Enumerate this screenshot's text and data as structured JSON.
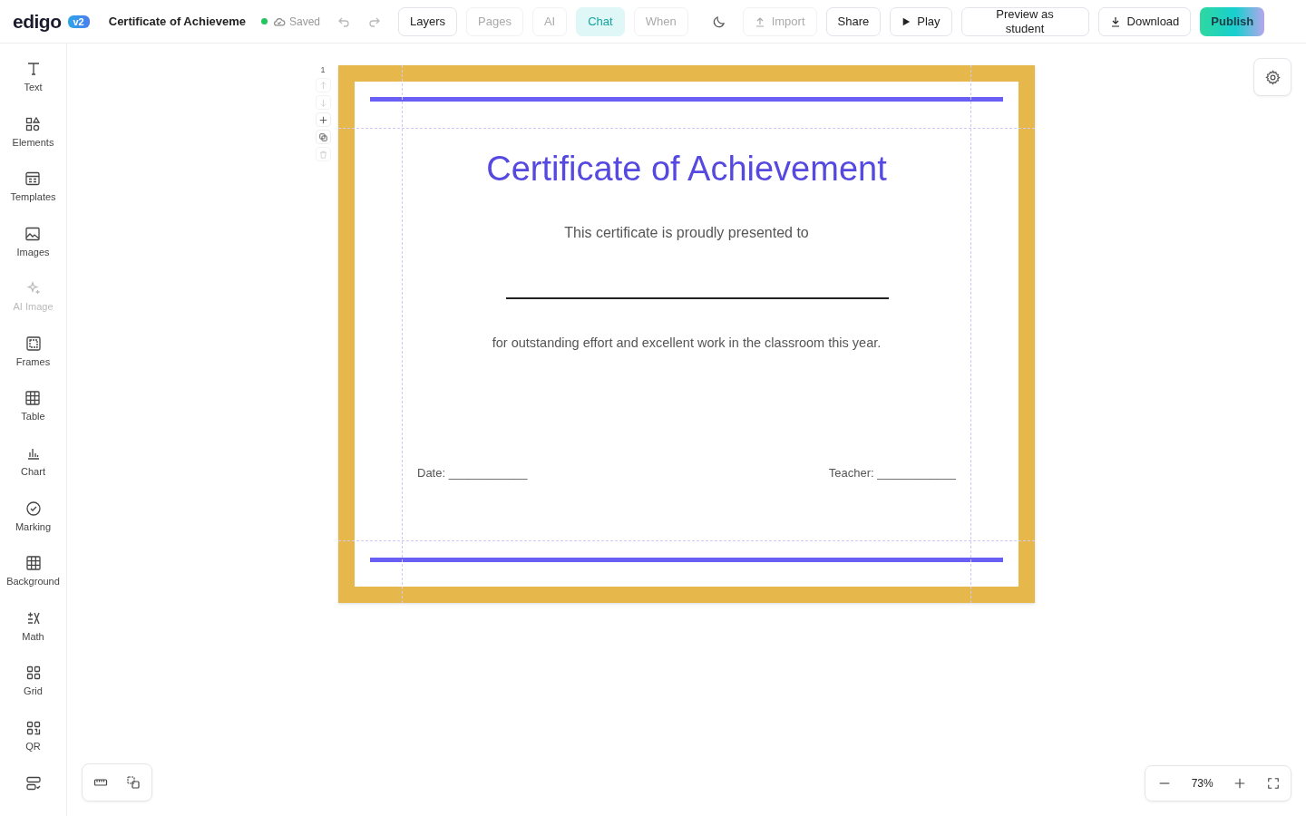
{
  "app": {
    "logo": "edigo",
    "version": "v2",
    "document_title": "Certificate of Achieveme",
    "save_status": "Saved"
  },
  "tabs": [
    {
      "label": "Layers",
      "selected": false,
      "disabled": false
    },
    {
      "label": "Pages",
      "selected": false,
      "disabled": true
    },
    {
      "label": "AI",
      "selected": false,
      "disabled": true
    },
    {
      "label": "Chat",
      "selected": true,
      "disabled": false
    },
    {
      "label": "When",
      "selected": false,
      "disabled": true
    }
  ],
  "actions": [
    {
      "kind": "import",
      "label": "Import",
      "disabled": true
    },
    {
      "kind": "share",
      "label": "Share",
      "disabled": false
    },
    {
      "kind": "play",
      "label": "Play",
      "disabled": false
    },
    {
      "kind": "preview",
      "label": "Preview as student",
      "disabled": false
    },
    {
      "kind": "download",
      "label": "Download",
      "disabled": false
    },
    {
      "kind": "publish",
      "label": "Publish",
      "disabled": false
    }
  ],
  "sidebar": {
    "items": [
      {
        "kind": "text",
        "label": "Text",
        "disabled": false
      },
      {
        "kind": "elements",
        "label": "Elements",
        "disabled": false
      },
      {
        "kind": "templates",
        "label": "Templates",
        "disabled": false
      },
      {
        "kind": "images",
        "label": "Images",
        "disabled": false
      },
      {
        "kind": "ai",
        "label": "AI Image",
        "disabled": true
      },
      {
        "kind": "frames",
        "label": "Frames",
        "disabled": false
      },
      {
        "kind": "table",
        "label": "Table",
        "disabled": false
      },
      {
        "kind": "chart",
        "label": "Chart",
        "disabled": false
      },
      {
        "kind": "marking",
        "label": "Marking",
        "disabled": false
      },
      {
        "kind": "background",
        "label": "Background",
        "disabled": false
      },
      {
        "kind": "math",
        "label": "Math",
        "disabled": false
      },
      {
        "kind": "grid",
        "label": "Grid",
        "disabled": false
      },
      {
        "kind": "qr",
        "label": "QR",
        "disabled": false
      },
      {
        "kind": "forms",
        "disabled": false
      }
    ]
  },
  "page_controls": {
    "page_number": "1",
    "buttons": [
      {
        "kind": "up",
        "disabled": true
      },
      {
        "kind": "down",
        "disabled": true
      },
      {
        "kind": "add",
        "disabled": false
      },
      {
        "kind": "copy",
        "disabled": false
      },
      {
        "kind": "delete",
        "disabled": true
      }
    ]
  },
  "certificate": {
    "title": "Certificate of Achievement",
    "subtitle": "This certificate is proudly presented to",
    "body": "for outstanding effort and excellent work in the classroom this year.",
    "date": "Date: ____________",
    "teacher": "Teacher: ____________"
  },
  "zoom": {
    "value": "73%"
  }
}
